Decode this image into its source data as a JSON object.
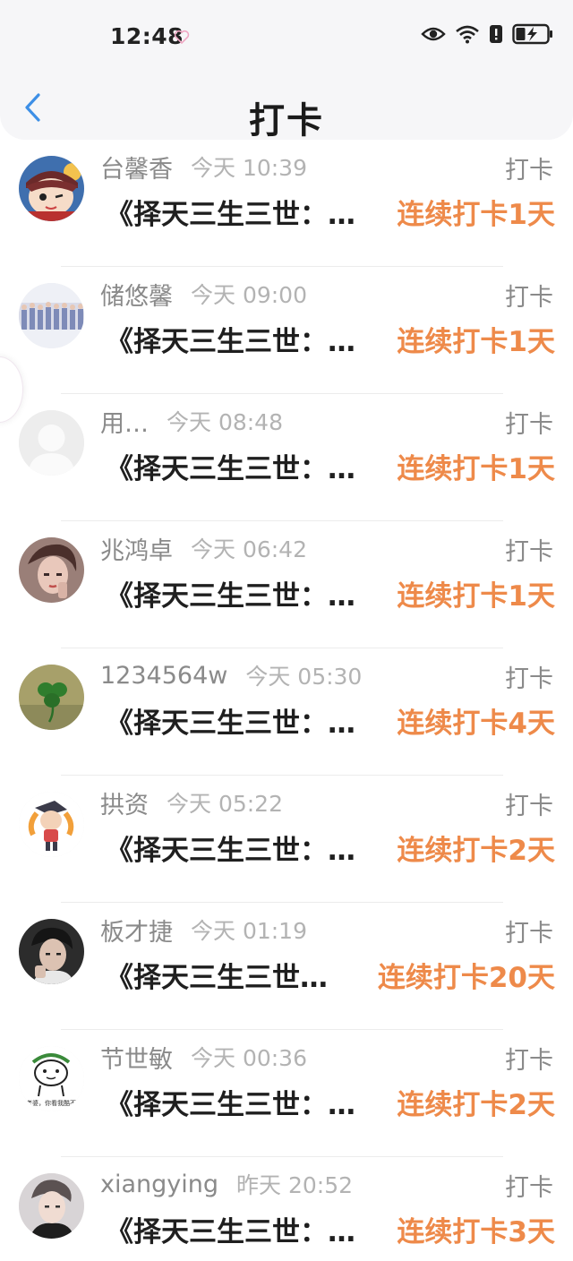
{
  "status_bar": {
    "time": "12:48"
  },
  "nav": {
    "title": "打卡"
  },
  "items": [
    {
      "name": "台馨香",
      "time": "今天 10:39",
      "action": "打卡",
      "book": "《择天三生三世：…",
      "streak": "连续打卡1天",
      "avatar": "cartoon-avatar"
    },
    {
      "name": "储悠馨",
      "time": "今天 09:00",
      "action": "打卡",
      "book": "《择天三生三世：…",
      "streak": "连续打卡1天",
      "avatar": "group-photo-avatar"
    },
    {
      "name": "用…",
      "time": "今天 08:48",
      "action": "打卡",
      "book": "《择天三生三世：…",
      "streak": "连续打卡1天",
      "avatar": "default-avatar"
    },
    {
      "name": "兆鸿卓",
      "time": "今天 06:42",
      "action": "打卡",
      "book": "《择天三生三世：…",
      "streak": "连续打卡1天",
      "avatar": "portrait-avatar"
    },
    {
      "name": "1234564w",
      "time": "今天 05:30",
      "action": "打卡",
      "book": "《择天三生三世：…",
      "streak": "连续打卡4天",
      "avatar": "clover-avatar"
    },
    {
      "name": "拱资",
      "time": "今天 05:22",
      "action": "打卡",
      "book": "《择天三生三世：…",
      "streak": "连续打卡2天",
      "avatar": "anime-avatar"
    },
    {
      "name": "板才捷",
      "time": "今天 01:19",
      "action": "打卡",
      "book": "《择天三生三世…",
      "streak": "连续打卡20天",
      "avatar": "portrait-avatar"
    },
    {
      "name": "节世敏",
      "time": "今天 00:36",
      "action": "打卡",
      "book": "《择天三生三世：…",
      "streak": "连续打卡2天",
      "avatar": "doodle-avatar",
      "avatar_caption": "老婆，你看我酷不"
    },
    {
      "name": "xiangying",
      "time": "昨天 20:52",
      "action": "打卡",
      "book": "《择天三生三世：…",
      "streak": "连续打卡3天",
      "avatar": "portrait-avatar"
    }
  ],
  "colors": {
    "accent": "#ee8a4a",
    "back_arrow": "#3d8fe6"
  }
}
